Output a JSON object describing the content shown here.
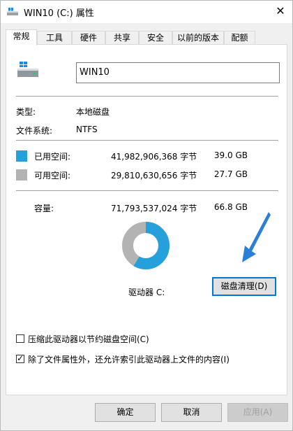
{
  "window": {
    "title": "WIN10 (C:) 属性",
    "close_glyph": "✕"
  },
  "tabs": [
    {
      "label": "常规",
      "active": true
    },
    {
      "label": "工具"
    },
    {
      "label": "硬件"
    },
    {
      "label": "共享"
    },
    {
      "label": "安全"
    },
    {
      "label": "以前的版本"
    },
    {
      "label": "配额"
    }
  ],
  "general": {
    "volume_name": "WIN10",
    "type_label": "类型:",
    "type_value": "本地磁盘",
    "fs_label": "文件系统:",
    "fs_value": "NTFS",
    "used_label": "已用空间:",
    "used_bytes": "41,982,906,368 字节",
    "used_gb": "39.0 GB",
    "free_label": "可用空间:",
    "free_bytes": "29,810,630,656 字节",
    "free_gb": "27.7 GB",
    "capacity_label": "容量:",
    "capacity_bytes": "71,793,537,024 字节",
    "capacity_gb": "66.8 GB",
    "drive_label": "驱动器 C:",
    "cleanup_button": "磁盘清理(D)",
    "compress_label": "压缩此驱动器以节约磁盘空间(C)",
    "compress_checked": false,
    "index_label": "除了文件属性外，还允许索引此驱动器上文件的内容(I)",
    "index_checked": true,
    "used_fraction": 0.585
  },
  "colors": {
    "used": "#26a0da",
    "free": "#b3b3b3",
    "arrow": "#2b7fd6"
  },
  "footer": {
    "ok": "确定",
    "cancel": "取消",
    "apply": "应用(A)"
  }
}
